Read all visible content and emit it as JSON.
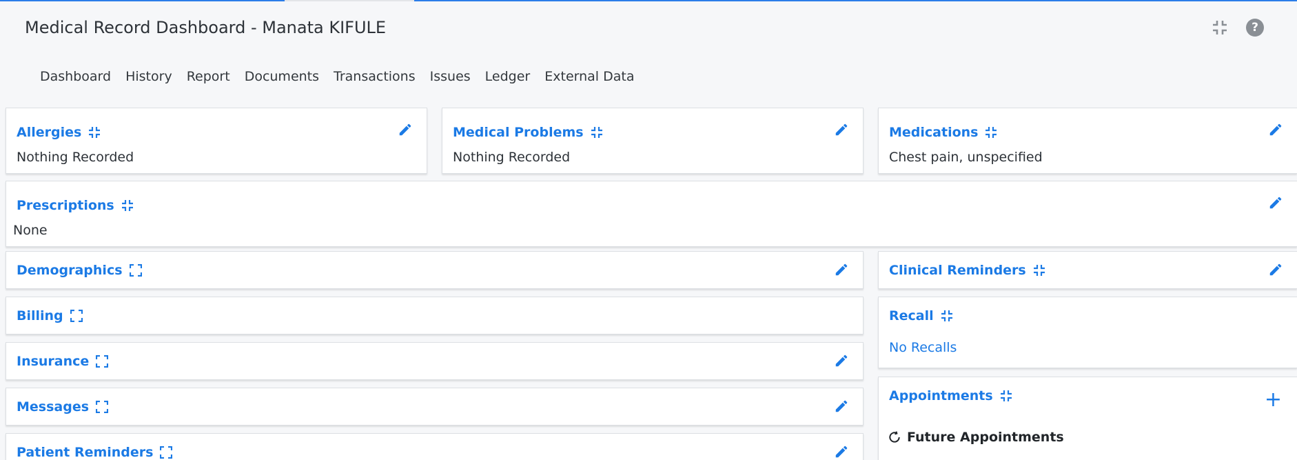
{
  "page": {
    "title": "Medical Record Dashboard - Manata KIFULE"
  },
  "header_icons": {
    "collapse": "collapse-icon",
    "help": "?"
  },
  "tabs": [
    "Dashboard",
    "History",
    "Report",
    "Documents",
    "Transactions",
    "Issues",
    "Ledger",
    "External Data"
  ],
  "cards": {
    "allergies": {
      "title": "Allergies",
      "body": "Nothing Recorded"
    },
    "medical_problems": {
      "title": "Medical Problems",
      "body": "Nothing Recorded"
    },
    "medications": {
      "title": "Medications",
      "body": "Chest pain, unspecified"
    },
    "prescriptions": {
      "title": "Prescriptions",
      "body": "None"
    },
    "demographics": {
      "title": "Demographics"
    },
    "billing": {
      "title": "Billing"
    },
    "insurance": {
      "title": "Insurance"
    },
    "messages": {
      "title": "Messages"
    },
    "patient_reminders": {
      "title": "Patient Reminders"
    },
    "clinical_reminders": {
      "title": "Clinical Reminders"
    },
    "recall": {
      "title": "Recall",
      "body": "No Recalls"
    },
    "appointments": {
      "title": "Appointments",
      "add": "+",
      "future_label": "Future Appointments"
    }
  },
  "colors": {
    "accent": "#1b7ae5",
    "background": "#f6f7f9",
    "progress": "#2b7de9"
  }
}
